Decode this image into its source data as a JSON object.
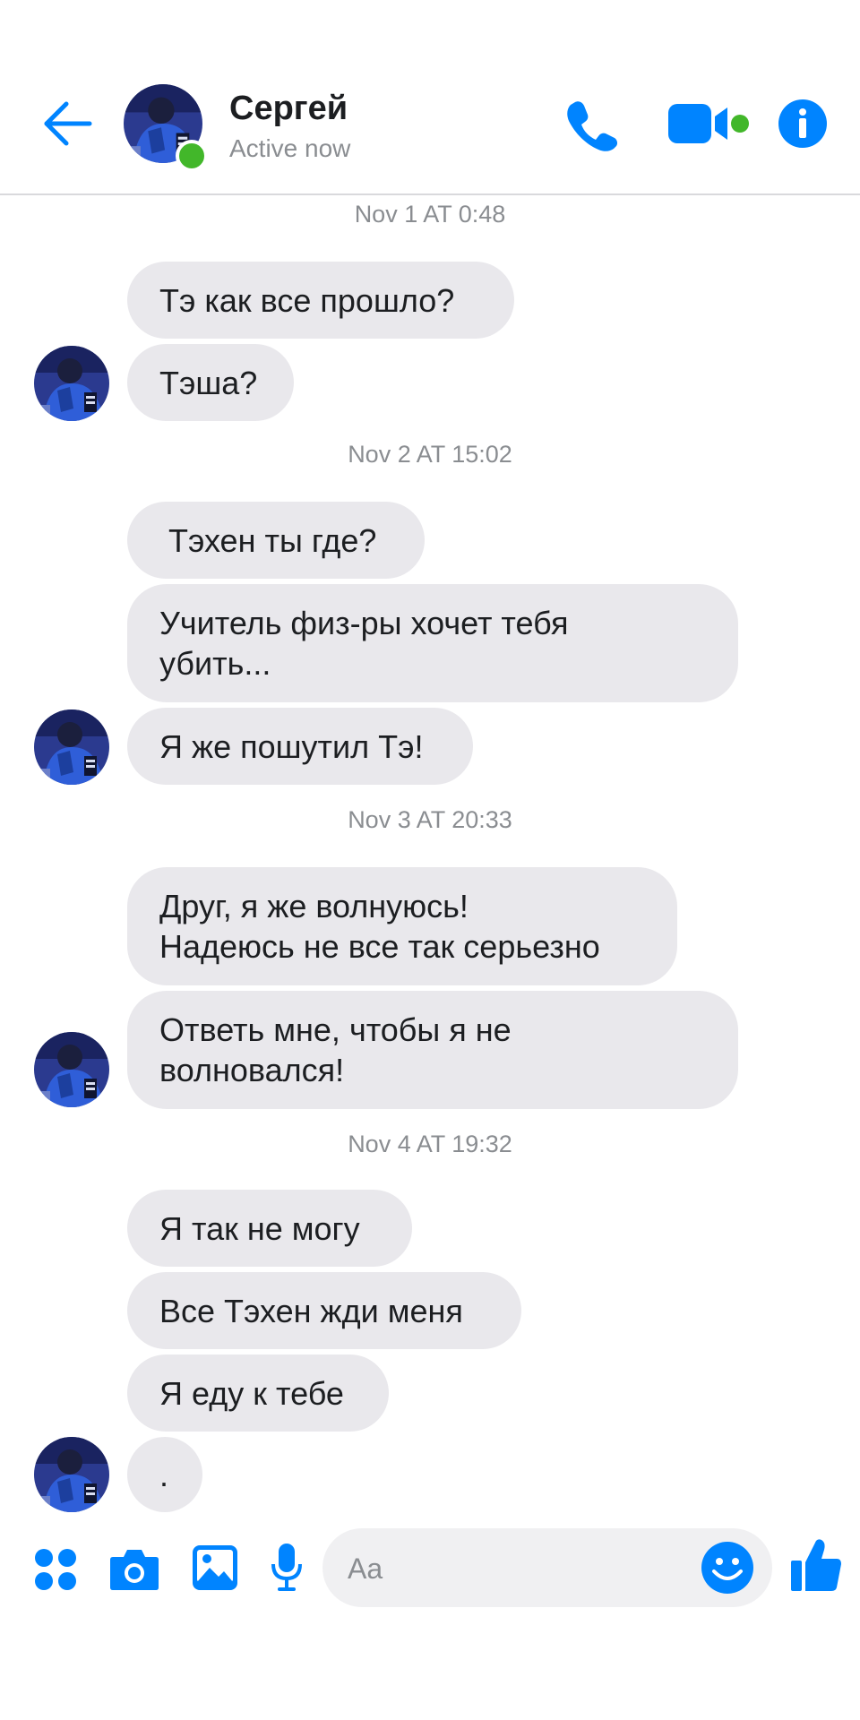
{
  "colors": {
    "accent": "#0084ff",
    "online": "#42b72a",
    "bubble": "#e9e8ec",
    "meta": "#8a8d91"
  },
  "header": {
    "name": "Сергей",
    "status": "Active now",
    "icons": [
      "back-arrow-icon",
      "phone-icon",
      "video-camera-icon",
      "info-icon"
    ]
  },
  "messages": [
    {
      "timestamp": "Nov 1 AT 0:48",
      "bubbles": [
        "Тэ как все прошло?",
        "Тэша?"
      ]
    },
    {
      "timestamp": "Nov 2 AT 15:02",
      "bubbles": [
        " Тэхен ты где?",
        "Учитель физ-ры хочет тебя\nубить...",
        "Я же пошутил Тэ!"
      ]
    },
    {
      "timestamp": "Nov 3 AT 20:33",
      "bubbles": [
        "Друг, я же волнуюсь!\nНадеюсь не все так серьезно",
        "Ответь мне, чтобы я не\nволновался!"
      ]
    },
    {
      "timestamp": "Nov 4 AT 19:32",
      "bubbles": [
        "Я так не могу",
        "Все Тэхен жди меня",
        "Я еду к тебе",
        "."
      ]
    }
  ],
  "composer": {
    "placeholder": "Aa",
    "icons": [
      "apps-grid-icon",
      "camera-icon",
      "image-gallery-icon",
      "microphone-icon",
      "emoji-icon",
      "thumbs-up-icon"
    ]
  }
}
